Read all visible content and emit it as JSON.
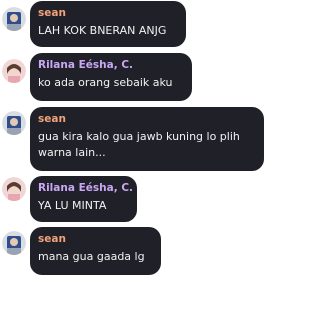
{
  "colors": {
    "bubble_bg": "#202128",
    "text": "#f2f2f4",
    "name_sean": "#f2a27a",
    "name_rilana": "#c9a7f5"
  },
  "messages": [
    {
      "sender": "sean",
      "avatar_icon": "sean-avatar-icon",
      "text": "LAH KOK BNERAN ANJG"
    },
    {
      "sender": "Rilana Eésha, C.",
      "avatar_icon": "rilana-avatar-icon",
      "text": "ko ada orang sebaik aku"
    },
    {
      "sender": "sean",
      "avatar_icon": "sean-avatar-icon",
      "text": "gua kira kalo gua jawb kuning lo plih warna lain..."
    },
    {
      "sender": "Rilana Eésha, C.",
      "avatar_icon": "rilana-avatar-icon",
      "text": "YA LU MINTA"
    },
    {
      "sender": "sean",
      "avatar_icon": "sean-avatar-icon",
      "text": "mana gua gaada lg"
    }
  ]
}
